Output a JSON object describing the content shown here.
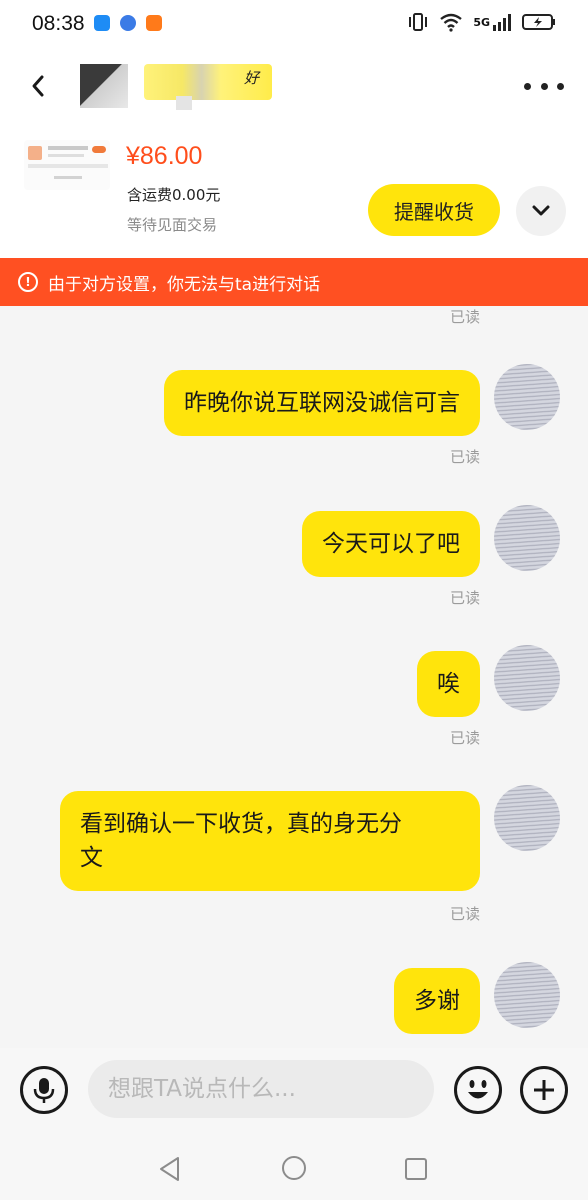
{
  "status_bar": {
    "time": "08:38",
    "network": "5G"
  },
  "header": {
    "name_suffix": "好"
  },
  "product": {
    "price": "¥86.00",
    "shipping": "含运费0.00元",
    "status": "等待见面交易",
    "remind_button": "提醒收货"
  },
  "banner": {
    "text": "由于对方设置，你无法与ta进行对话"
  },
  "messages": [
    {
      "text": "昨晚你说互联网没诚信可言",
      "read": "已读"
    },
    {
      "text": "今天可以了吧",
      "read": "已读"
    },
    {
      "text": "唉",
      "read": "已读"
    },
    {
      "text": "看到确认一下收货，真的身无分\n文",
      "read": "已读"
    },
    {
      "text": "多谢"
    }
  ],
  "top_read": "已读",
  "input": {
    "placeholder": "想跟TA说点什么..."
  },
  "icons": {
    "back": "back-arrow-icon",
    "more": "more-dots-icon",
    "expand": "chevron-down-icon",
    "mic": "microphone-icon",
    "emoji": "emoji-icon",
    "plus": "plus-icon",
    "warning": "warning-circle-icon"
  },
  "colors": {
    "accent_yellow": "#ffe40c",
    "price_orange": "#ff4e1c",
    "banner_red": "#ff5022",
    "read_gray": "#9b9b9b"
  }
}
